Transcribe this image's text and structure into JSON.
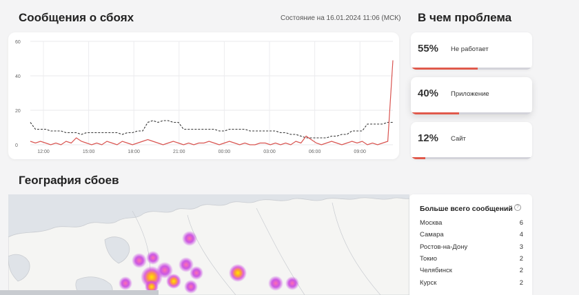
{
  "header": {
    "title": "Сообщения о сбоях",
    "status_text": "Состояние на 16.01.2024 11:06 (МСК)"
  },
  "chart_data": {
    "type": "line",
    "x_ticks": [
      "12:00",
      "15:00",
      "18:00",
      "21:00",
      "00:00",
      "03:00",
      "06:00",
      "09:00"
    ],
    "y_ticks": [
      0,
      20,
      40,
      60
    ],
    "ylim": [
      0,
      60
    ],
    "grid": true,
    "series": [
      {
        "style": "dashed",
        "color": "#333333",
        "values": [
          13,
          9,
          9,
          9,
          8,
          8,
          8,
          7,
          7,
          7,
          6,
          7,
          7,
          7,
          7,
          7,
          7,
          7,
          6,
          7,
          7,
          8,
          8,
          13,
          14,
          13,
          14,
          14,
          13,
          13,
          9,
          9,
          9,
          9,
          9,
          9,
          9,
          8,
          8,
          9,
          9,
          9,
          9,
          8,
          8,
          8,
          8,
          8,
          8,
          7,
          7,
          6,
          6,
          5,
          4,
          4,
          4,
          4,
          4,
          5,
          5,
          6,
          6,
          8,
          8,
          8,
          12,
          12,
          12,
          12,
          13,
          13
        ]
      },
      {
        "style": "solid",
        "color": "#d9534f",
        "values": [
          2,
          1,
          2,
          1,
          0,
          1,
          0,
          2,
          1,
          4,
          2,
          1,
          0,
          1,
          0,
          2,
          1,
          0,
          2,
          1,
          0,
          1,
          2,
          3,
          2,
          1,
          0,
          1,
          2,
          1,
          0,
          1,
          0,
          1,
          1,
          2,
          1,
          0,
          1,
          2,
          1,
          0,
          1,
          0,
          0,
          1,
          1,
          0,
          1,
          0,
          1,
          0,
          2,
          1,
          5,
          3,
          1,
          0,
          1,
          2,
          1,
          0,
          1,
          2,
          1,
          2,
          0,
          1,
          0,
          1,
          2,
          49
        ]
      }
    ]
  },
  "problems": {
    "title": "В чем проблема",
    "items": [
      {
        "percent": "55%",
        "label": "Не работает",
        "fraction": 0.55
      },
      {
        "percent": "40%",
        "label": "Приложение",
        "fraction": 0.4
      },
      {
        "percent": "12%",
        "label": "Сайт",
        "fraction": 0.12
      }
    ]
  },
  "geo": {
    "title": "География сбоев",
    "panel_title": "Больше всего сообщений",
    "help_icon": "question-circle-icon",
    "cities": [
      {
        "name": "Москва",
        "count": "6"
      },
      {
        "name": "Самара",
        "count": "4"
      },
      {
        "name": "Ростов-на-Дону",
        "count": "3"
      },
      {
        "name": "Токио",
        "count": "2"
      },
      {
        "name": "Челябинск",
        "count": "2"
      },
      {
        "name": "Курск",
        "count": "2"
      }
    ]
  },
  "colors": {
    "accent": "#e0594b",
    "heat_outer": "#c43de0",
    "heat_inner": "#ffd400",
    "background": "#f4f4f5"
  }
}
